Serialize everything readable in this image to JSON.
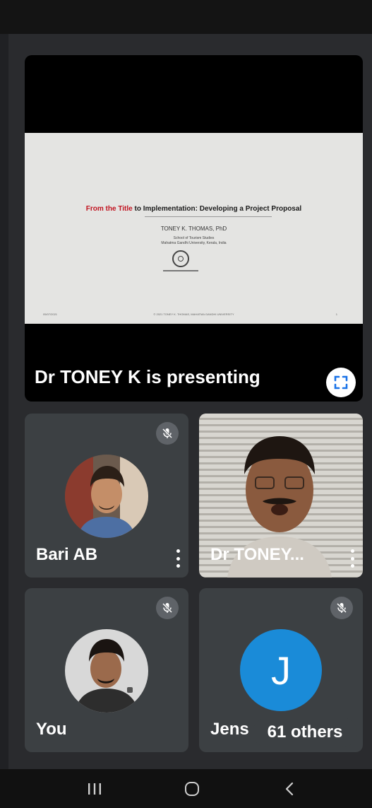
{
  "presentation": {
    "label": "Dr TONEY K is presenting",
    "fullscreen_icon": "fullscreen-icon",
    "slide": {
      "title_highlight": "From the Title",
      "title_rest": " to Implementation: Developing a Project Proposal",
      "author": "TONEY K. THOMAS, PhD",
      "school_line1": "School of Tourism Studies",
      "school_line2": "Mahatma Gandhi University, Kerala, India",
      "footer_left": "05/07/2021",
      "footer_center": "© 2021 TONEY K. THOMAS, MAHATMA GANDHI UNIVERSITY",
      "footer_right": "1"
    }
  },
  "participants": [
    {
      "name": "Bari AB",
      "muted": true,
      "has_menu": true
    },
    {
      "name": "Dr TONEY...",
      "muted": false,
      "has_menu": true
    },
    {
      "name": "You",
      "muted": true,
      "has_menu": false
    },
    {
      "name": "Jens",
      "initial": "J",
      "muted": true,
      "has_menu": false
    }
  ],
  "others_count_label": "61 others",
  "colors": {
    "background": "#202124",
    "tile": "#3c4043",
    "avatar_blue": "#1a8bd8",
    "slide_title_red": "#c1121f"
  },
  "nav": {
    "recents_icon": "recent-apps-icon",
    "home_icon": "home-icon",
    "back_icon": "back-icon"
  }
}
